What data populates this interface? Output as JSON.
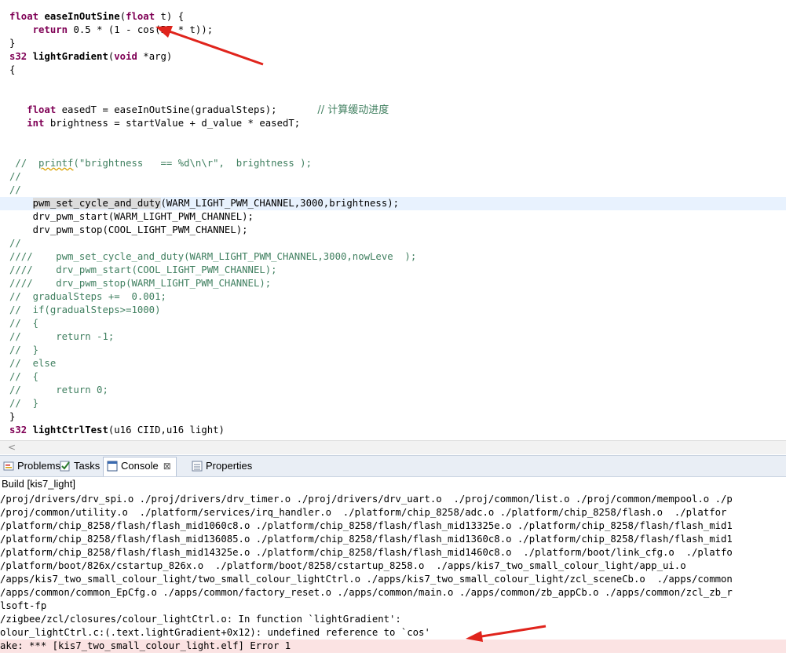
{
  "editor": {
    "l1": {
      "kw": "float",
      "fn": "easeInOutSine",
      "rest": "(",
      "kw2": "float",
      "rest2": " t) {"
    },
    "l2": {
      "kw": "return",
      "rest": " 0.5 * (1 - cos(PI * t));"
    },
    "l3": "}",
    "l4": {
      "kw": "s32",
      "fn": "lightGradient",
      "rest": "(",
      "kw2": "void",
      "rest2": " *arg)"
    },
    "l5": "{",
    "l8": {
      "kw": "float",
      "rest": " easedT = easeInOutSine(gradualSteps);",
      "comment": "// 计算缓动进度"
    },
    "l9": {
      "kw": "int",
      "rest": " brightness = startValue + d_value * easedT;"
    },
    "l12": {
      "a": " //  ",
      "b": "printf",
      "c": "(\"brightness   == %d\\n\\r\",  brightness );"
    },
    "l13": "//",
    "l14": "//",
    "l15": {
      "a": "pwm_set_cycle_and_duty",
      "b": "(WARM_LIGHT_PWM_CHANNEL,3000,brightness);"
    },
    "l16": "    drv_pwm_start(WARM_LIGHT_PWM_CHANNEL);",
    "l17": "    drv_pwm_stop(COOL_LIGHT_PWM_CHANNEL);",
    "l18": "//",
    "l19": "////    pwm_set_cycle_and_duty(WARM_LIGHT_PWM_CHANNEL,3000,nowLeve  );",
    "l20": "////    drv_pwm_start(COOL_LIGHT_PWM_CHANNEL);",
    "l21": "////    drv_pwm_stop(WARM_LIGHT_PWM_CHANNEL);",
    "l22": "//  gradualSteps +=  0.001;",
    "l23": "//  if(gradualSteps>=1000)",
    "l24": "//  {",
    "l25": "//      return -1;",
    "l26": "//  }",
    "l27": "//  else",
    "l28": "//  {",
    "l29": "//      return 0;",
    "l30": "//  }",
    "l31": "}",
    "l32": {
      "kw": "s32",
      "fn": "lightCtrlTest",
      "rest": "(u16 CIID,u16 light)"
    }
  },
  "tabs": [
    {
      "label": "Problems",
      "icon": "problems-icon"
    },
    {
      "label": "Tasks",
      "icon": "tasks-icon"
    },
    {
      "label": "Console",
      "icon": "console-icon",
      "close": "⊠"
    },
    {
      "label": "Properties",
      "icon": "properties-icon"
    }
  ],
  "console": {
    "title": "Build [kis7_light]",
    "lines": [
      "/proj/drivers/drv_spi.o ./proj/drivers/drv_timer.o ./proj/drivers/drv_uart.o  ./proj/common/list.o ./proj/common/mempool.o ./p",
      "/proj/common/utility.o  ./platform/services/irq_handler.o  ./platform/chip_8258/adc.o ./platform/chip_8258/flash.o  ./platfor",
      "/platform/chip_8258/flash/flash_mid1060c8.o ./platform/chip_8258/flash/flash_mid13325e.o ./platform/chip_8258/flash/flash_mid1",
      "/platform/chip_8258/flash/flash_mid136085.o ./platform/chip_8258/flash/flash_mid1360c8.o ./platform/chip_8258/flash/flash_mid1",
      "/platform/chip_8258/flash/flash_mid14325e.o ./platform/chip_8258/flash/flash_mid1460c8.o  ./platform/boot/link_cfg.o  ./platfo",
      "/platform/boot/826x/cstartup_826x.o  ./platform/boot/8258/cstartup_8258.o  ./apps/kis7_two_small_colour_light/app_ui.o",
      "/apps/kis7_two_small_colour_light/two_small_colour_lightCtrl.o ./apps/kis7_two_small_colour_light/zcl_sceneCb.o  ./apps/common",
      "/apps/common/common_EpCfg.o ./apps/common/factory_reset.o ./apps/common/main.o ./apps/common/zb_appCb.o ./apps/common/zcl_zb_r",
      "lsoft-fp",
      "/zigbee/zcl/closures/colour_lightCtrl.o: In function `lightGradient':",
      "olour_lightCtrl.c:(.text.lightGradient+0x12): undefined reference to `cos'",
      "ake: *** [kis7_two_small_colour_light.elf] Error 1"
    ]
  },
  "annotation_color": "#e0241c"
}
